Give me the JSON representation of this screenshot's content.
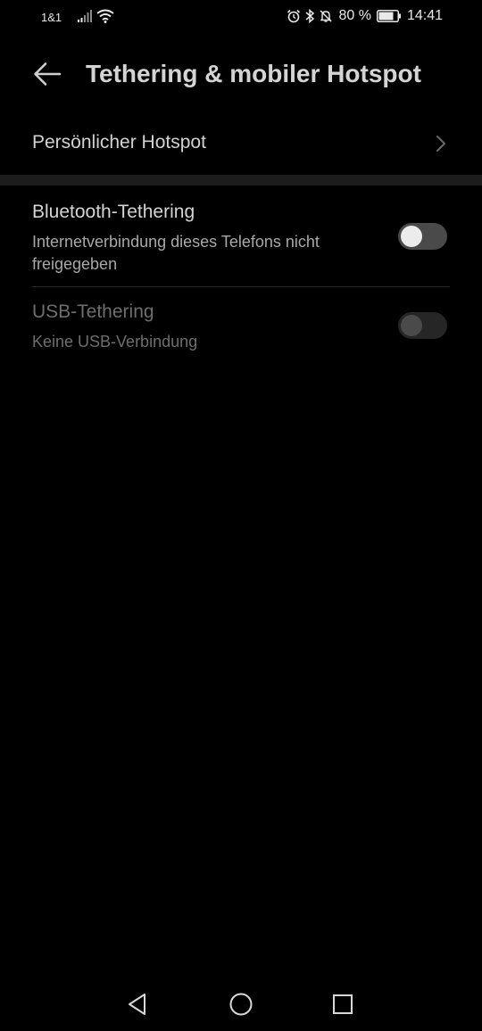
{
  "status_bar": {
    "carrier": "1&1",
    "battery_percent": "80 %",
    "battery_level": 0.8,
    "time": "14:41",
    "icons": [
      "signal-icon",
      "wifi-icon",
      "alarm-icon",
      "bluetooth-icon",
      "mute-bell-icon",
      "battery-icon"
    ]
  },
  "header": {
    "back_icon": "back-arrow-icon",
    "title": "Tethering & mobiler Hotspot"
  },
  "hotspot": {
    "label": "Persönlicher Hotspot",
    "icon": "chevron-right-icon"
  },
  "bluetooth_tethering": {
    "title": "Bluetooth-Tethering",
    "subtitle": "Internetverbindung dieses Telefons nicht freigegeben",
    "enabled": false
  },
  "usb_tethering": {
    "title": "USB-Tethering",
    "subtitle": "Keine USB-Verbindung",
    "enabled": false,
    "disabled": true
  },
  "nav_bar": {
    "icons": [
      "nav-back-icon",
      "nav-home-icon",
      "nav-recent-icon"
    ]
  },
  "colors": {
    "background": "#000000",
    "section_divider": "#1c1c1c",
    "toggle_track": "#4a4a4a",
    "toggle_knob": "#ececec"
  }
}
